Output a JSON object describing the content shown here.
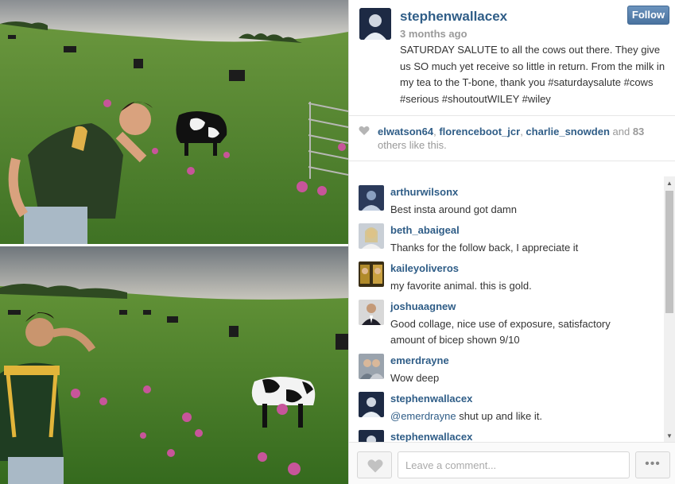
{
  "post": {
    "username": "stephenwallacex",
    "time": "3 months ago",
    "follow_label": "Follow",
    "caption": "SATURDAY SALUTE to all the cows out there. They give us SO much yet receive so little in return. From the milk in my tea to the T-bone, thank you #saturdaysalute #cows #serious #shoutoutWILEY #wiley"
  },
  "likes": {
    "users": [
      "elwatson64",
      "florenceboot_jcr",
      "charlie_snowden"
    ],
    "separator": ", ",
    "and": " and ",
    "count": "83",
    "suffix": " others like this."
  },
  "comments": [
    {
      "user": "arthurwilsonx",
      "text": "Best insta around got damn",
      "avatar_color": "#2b3a5a"
    },
    {
      "user": "beth_abaigeal",
      "text": "Thanks for the follow back, I appreciate it",
      "avatar_color": "#c9cfd6"
    },
    {
      "user": "kaileyoliveros",
      "text": "my favorite animal. this is gold.",
      "avatar_color": "#5a4a20"
    },
    {
      "user": "joshuaagnew",
      "text": "Good collage, nice use of exposure, satisfactory amount of bicep shown 9/10",
      "avatar_color": "#3a3a3a"
    },
    {
      "user": "emerdrayne",
      "text": "Wow deep",
      "avatar_color": "#9aa3ad"
    },
    {
      "user": "stephenwallacex",
      "mention": "@emerdrayne",
      "text": " shut up and like it.",
      "avatar_color": "#1d2a44"
    },
    {
      "user": "stephenwallacex",
      "text": "",
      "avatar_color": "#1d2a44"
    }
  ],
  "footer": {
    "comment_placeholder": "Leave a comment...",
    "more_label": "•••"
  },
  "icons": {
    "heart": "heart-icon",
    "more": "more-dots-icon",
    "scroll_up": "▲",
    "scroll_down": "▼"
  },
  "colors": {
    "username": "#2f5d87",
    "follow_button": "#4a739f",
    "muted": "#999999"
  }
}
